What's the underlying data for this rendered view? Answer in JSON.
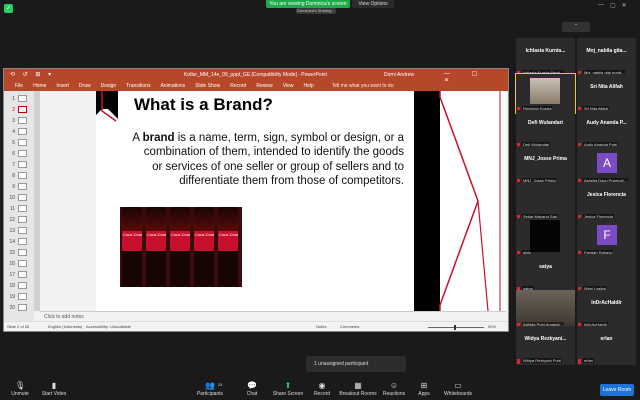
{
  "zoom": {
    "viewing_banner": "You are viewing Dominica's screen",
    "view_options": "View Options",
    "sharing_sub": "Dominica's Sharing..."
  },
  "ppt": {
    "quick_access": "⟲ ↺ ⊞ ▾",
    "filename": "Kotler_MM_14e_09_pppt_GE [Compatibility Mode] - PowerPoint",
    "user": "Dorni Andrew",
    "window_controls": "— ▢ ✕",
    "tabs": [
      "File",
      "Home",
      "Insert",
      "Draw",
      "Design",
      "Transitions",
      "Animations",
      "Slide Show",
      "Record",
      "Review",
      "View",
      "Help"
    ],
    "tell_me": "Tell me what you want to do",
    "thumb_numbers": [
      "1",
      "2",
      "3",
      "4",
      "5",
      "6",
      "7",
      "8",
      "9",
      "10",
      "11",
      "12",
      "13",
      "14",
      "15",
      "16",
      "17",
      "18",
      "19",
      "20"
    ],
    "notes_placeholder": "Click to add notes",
    "status": {
      "slide": "Slide 2 of 26",
      "language": "English (Indonesia)",
      "accessibility": "Accessibility: Unavailable",
      "notes": "Notes",
      "comments": "Comments",
      "zoom": "90%"
    }
  },
  "slide": {
    "title": "What is a Brand?",
    "body_prefix": "A ",
    "body_bold": "brand",
    "body_rest": " is a name, term, sign, symbol or design, or a combination of them, intended to identify the goods or services of one seller or group of sellers and to differentiate them from those of competitors.",
    "bottle_label": "Coca-Cola"
  },
  "participants": [
    {
      "big": "Ichlasia Kurnia...",
      "small": "Ichlasia Kurnia Meyri..."
    },
    {
      "big": "Mnj_nabila gita...",
      "small": "Mnj_nabila gita nuraf..."
    },
    {
      "big": "",
      "small": "Reychan Kostra"
    },
    {
      "big": "Sri Nita Alifah",
      "small": "Sri Nita Alifah"
    },
    {
      "big": "Defi Wulandari",
      "small": "Defi Wulandari"
    },
    {
      "big": "Audy Ananda P...",
      "small": "Audy Ananda Putri"
    },
    {
      "big": "MNJ_Josse Prima",
      "small": "MNJ_Josse Prima"
    },
    {
      "big": "A",
      "small": "Ashelia Dayu Pramudi..."
    },
    {
      "big": "",
      "small": "Sekar Mayang Sari"
    },
    {
      "big": "Jesica Florencia",
      "small": "Jesica Florencia"
    },
    {
      "big": "",
      "small": "alvin"
    },
    {
      "big": "F",
      "small": "Faridah Rahayu"
    },
    {
      "big": "satya",
      "small": "satya"
    },
    {
      "big": "",
      "small": "Weni Lasboi"
    },
    {
      "big": "",
      "small": "Adhida Putri Anggrai..."
    },
    {
      "big": "InDrAcHaIdIr",
      "small": "InDrAcHaIdIr"
    },
    {
      "big": "Widya Rezkyani...",
      "small": "Widya Rezkyani Putri"
    },
    {
      "big": "erlan",
      "small": "erlan"
    }
  ],
  "unassigned": "1 unassigned participant",
  "toolbar": {
    "unmute": "Unmute",
    "start_video": "Start Video",
    "participants": "Participants",
    "participants_count": "24",
    "chat": "Chat",
    "share_screen": "Share Screen",
    "record": "Record",
    "breakout": "Breakout Rooms",
    "reactions": "Reactions",
    "apps": "Apps",
    "whiteboards": "Whiteboards",
    "leave": "Leave Room"
  },
  "colors": {
    "ppt_red": "#b7472a",
    "zoom_green": "#23d160",
    "leave_blue": "#1f73d8",
    "slide_accent": "#c8102e"
  }
}
